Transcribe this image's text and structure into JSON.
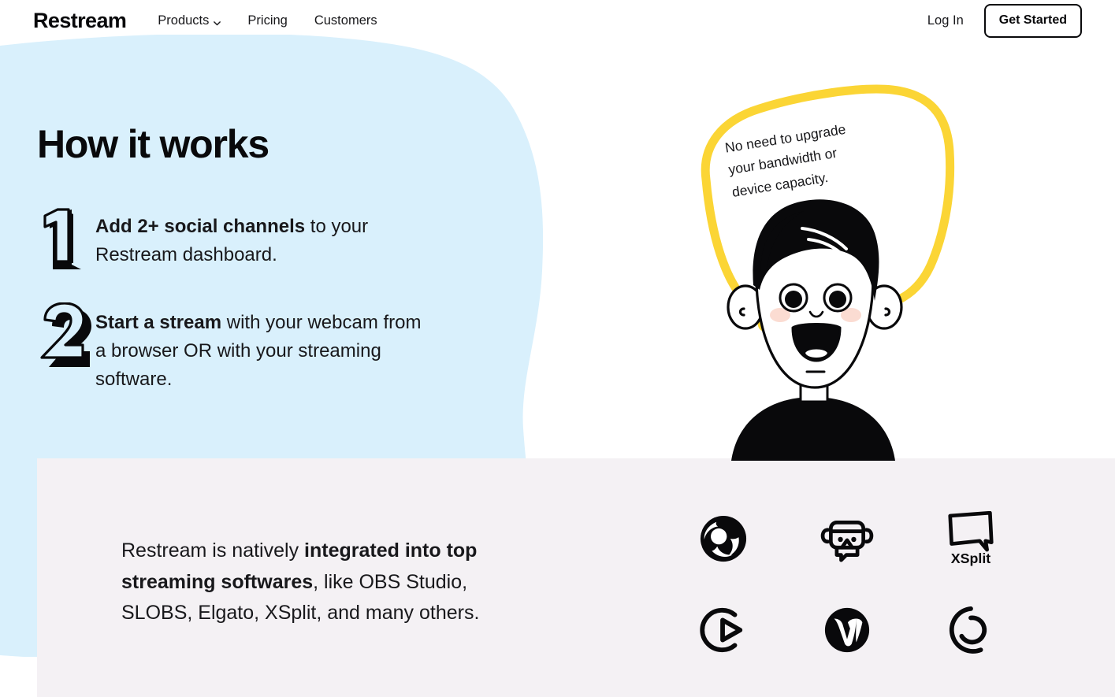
{
  "brand": {
    "name": "Restream"
  },
  "nav": {
    "links": [
      {
        "label": "Products",
        "has_dropdown": true,
        "icon": "chevron-down-icon"
      },
      {
        "label": "Pricing",
        "has_dropdown": false
      },
      {
        "label": "Customers",
        "has_dropdown": false
      }
    ],
    "login_label": "Log In",
    "cta_label": "Get Started"
  },
  "hero": {
    "title": "How it works",
    "steps": [
      {
        "number": "1",
        "bold": "Add 2+ social channels",
        "rest": " to your Restream dashboard."
      },
      {
        "number": "2",
        "bold": "Start a stream",
        "rest": " with your webcam from a browser OR with your streaming software."
      }
    ]
  },
  "illustration": {
    "name": "person-with-speech-bubble",
    "bubble_lines": [
      "No need to upgrade",
      "your bandwidth or",
      "device capacity."
    ]
  },
  "integration": {
    "text_start": "Restream is natively ",
    "text_bold": "integrated into top streaming softwares",
    "text_end": ", like OBS Studio, SLOBS, Elgato, XSplit, and many others.",
    "logos": [
      {
        "name": "obs-studio-logo",
        "label": "OBS Studio"
      },
      {
        "name": "streamlabs-obs-logo",
        "label": "Streamlabs OBS"
      },
      {
        "name": "xsplit-logo",
        "label": "XSplit"
      },
      {
        "name": "elgato-logo",
        "label": "Elgato"
      },
      {
        "name": "wirecast-logo",
        "label": "Wirecast"
      },
      {
        "name": "ecamm-logo",
        "label": "Ecamm Live"
      }
    ],
    "xsplit_wordmark": "XSplit"
  },
  "colors": {
    "accent_blue": "#d9f0fc",
    "panel_gray": "#f4f1f4",
    "bubble_yellow": "#fbd535",
    "ink": "#09090b",
    "blush": "#fbdcd2"
  }
}
